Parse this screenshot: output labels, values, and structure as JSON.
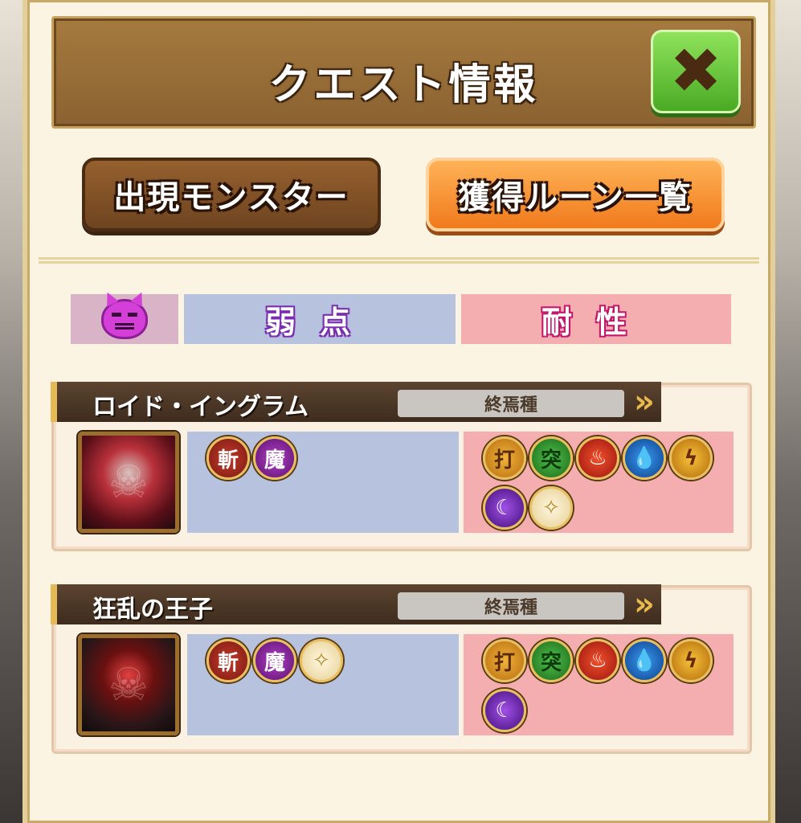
{
  "dialog": {
    "title": "クエスト情報",
    "close_icon": "✖"
  },
  "tabs": {
    "monsters_label": "出現モンスター",
    "runes_label": "獲得ルーン一覧"
  },
  "table_header": {
    "demon_icon": "demon-face-icon",
    "weakness_label": "弱点",
    "resistance_label": "耐性"
  },
  "monsters": [
    {
      "name": "ロイド・イングラム",
      "race": "終焉種",
      "weaknesses": [
        {
          "icon": "slash-icon",
          "label": "斬"
        },
        {
          "icon": "magic-icon",
          "label": "魔"
        }
      ],
      "resistances": [
        {
          "icon": "strike-icon",
          "label": "打"
        },
        {
          "icon": "thrust-icon",
          "label": "突"
        },
        {
          "icon": "fire-icon",
          "label": "♨"
        },
        {
          "icon": "water-icon",
          "label": "💧"
        },
        {
          "icon": "thunder-icon",
          "label": "ϟ"
        },
        {
          "icon": "dark-icon",
          "label": "☾"
        },
        {
          "icon": "light-icon",
          "label": "✧"
        }
      ]
    },
    {
      "name": "狂乱の王子",
      "race": "終焉種",
      "weaknesses": [
        {
          "icon": "slash-icon",
          "label": "斬"
        },
        {
          "icon": "magic-icon",
          "label": "魔"
        },
        {
          "icon": "light-icon",
          "label": "✧"
        }
      ],
      "resistances": [
        {
          "icon": "strike-icon",
          "label": "打"
        },
        {
          "icon": "thrust-icon",
          "label": "突"
        },
        {
          "icon": "fire-icon",
          "label": "♨"
        },
        {
          "icon": "water-icon",
          "label": "💧"
        },
        {
          "icon": "thunder-icon",
          "label": "ϟ"
        },
        {
          "icon": "dark-icon",
          "label": "☾"
        }
      ]
    }
  ],
  "colors": {
    "title_bar": "#8a6230",
    "close_button": "#4aaa24",
    "monsters_tab": "#6e4420",
    "runes_tab": "#f07a1c",
    "weakness_bg": "#b7c3de",
    "resistance_bg": "#f4aeb0"
  }
}
